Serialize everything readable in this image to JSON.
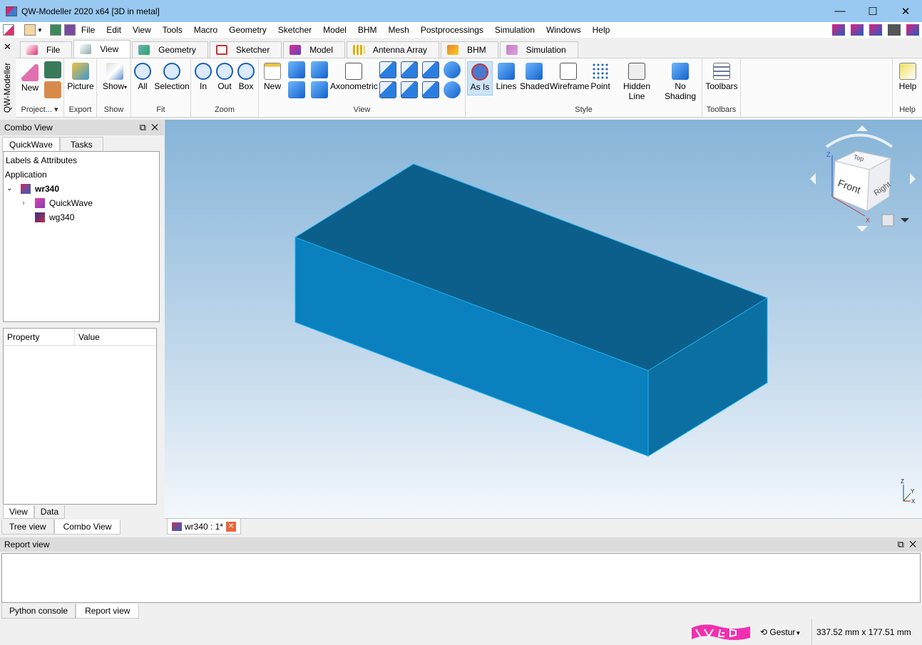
{
  "window": {
    "title": "QW-Modeller 2020 x64 [3D in metal]",
    "minimize": "—",
    "maximize": "☐",
    "close": "✕"
  },
  "menu": [
    "File",
    "Edit",
    "View",
    "Tools",
    "Macro",
    "Geometry",
    "Sketcher",
    "Model",
    "BHM",
    "Mesh",
    "Postprocessings",
    "Simulation",
    "Windows",
    "Help"
  ],
  "side_strip": {
    "label": "QW-Modeller",
    "close": "✕"
  },
  "ribbon_tabs": [
    {
      "label": "File",
      "icon": "file-icon"
    },
    {
      "label": "View",
      "icon": "view-cube-icon"
    },
    {
      "label": "Geometry",
      "icon": "geometry-icon"
    },
    {
      "label": "Sketcher",
      "icon": "sketcher-icon"
    },
    {
      "label": "Model",
      "icon": "model-icon"
    },
    {
      "label": "Antenna Array",
      "icon": "antenna-array-icon"
    },
    {
      "label": "BHM",
      "icon": "bhm-icon"
    },
    {
      "label": "Simulation",
      "icon": "simulation-icon"
    }
  ],
  "ribbon": {
    "project": {
      "label": "Project...",
      "new": "New"
    },
    "export": {
      "label": "Export",
      "picture": "Picture"
    },
    "show": {
      "label": "Show",
      "show": "Show"
    },
    "fit": {
      "label": "Fit",
      "all": "All",
      "selection": "Selection"
    },
    "zoom": {
      "label": "Zoom",
      "in": "In",
      "out": "Out",
      "box": "Box"
    },
    "view": {
      "label": "View",
      "new": "New",
      "axonometric": "Axonometric"
    },
    "style": {
      "label": "Style",
      "as_is": "As Is",
      "lines": "Lines",
      "shaded": "Shaded",
      "wireframe": "Wireframe",
      "point": "Point",
      "hidden_line": "Hidden Line",
      "no_shading": "No Shading"
    },
    "toolbars": {
      "label": "Toolbars",
      "toolbars": "Toolbars"
    },
    "help": {
      "label": "Help",
      "help": "Help"
    }
  },
  "combo": {
    "title": "Combo View",
    "tabs": [
      "QuickWave",
      "Tasks"
    ],
    "tree_header": "Labels & Attributes",
    "tree_root": "Application",
    "tree": [
      {
        "label": "wr340",
        "bold": true,
        "depth": 0
      },
      {
        "label": "QuickWave",
        "depth": 1
      },
      {
        "label": "wg340",
        "depth": 1
      }
    ],
    "prop_cols": [
      "Property",
      "Value"
    ],
    "view_tabs": [
      "View",
      "Data"
    ],
    "panel_tabs": [
      "Tree view",
      "Combo View"
    ]
  },
  "navcube": {
    "top": "Top",
    "front": "Front",
    "right": "Right",
    "axis_x": "X",
    "axis_z": "Z"
  },
  "axes": {
    "x": "X",
    "y": "Y",
    "z": "Z"
  },
  "doc_tab": {
    "label": "wr340 : 1*",
    "close": "✕"
  },
  "report": {
    "title": "Report view",
    "tabs": [
      "Python console",
      "Report view"
    ]
  },
  "status": {
    "gesture": "Gestur",
    "size": "337.52 mm x 177.51 mm"
  },
  "colors": {
    "box_top": "#0b5f8a",
    "box_front": "#0a80bf",
    "box_side": "#0b6fa2"
  }
}
